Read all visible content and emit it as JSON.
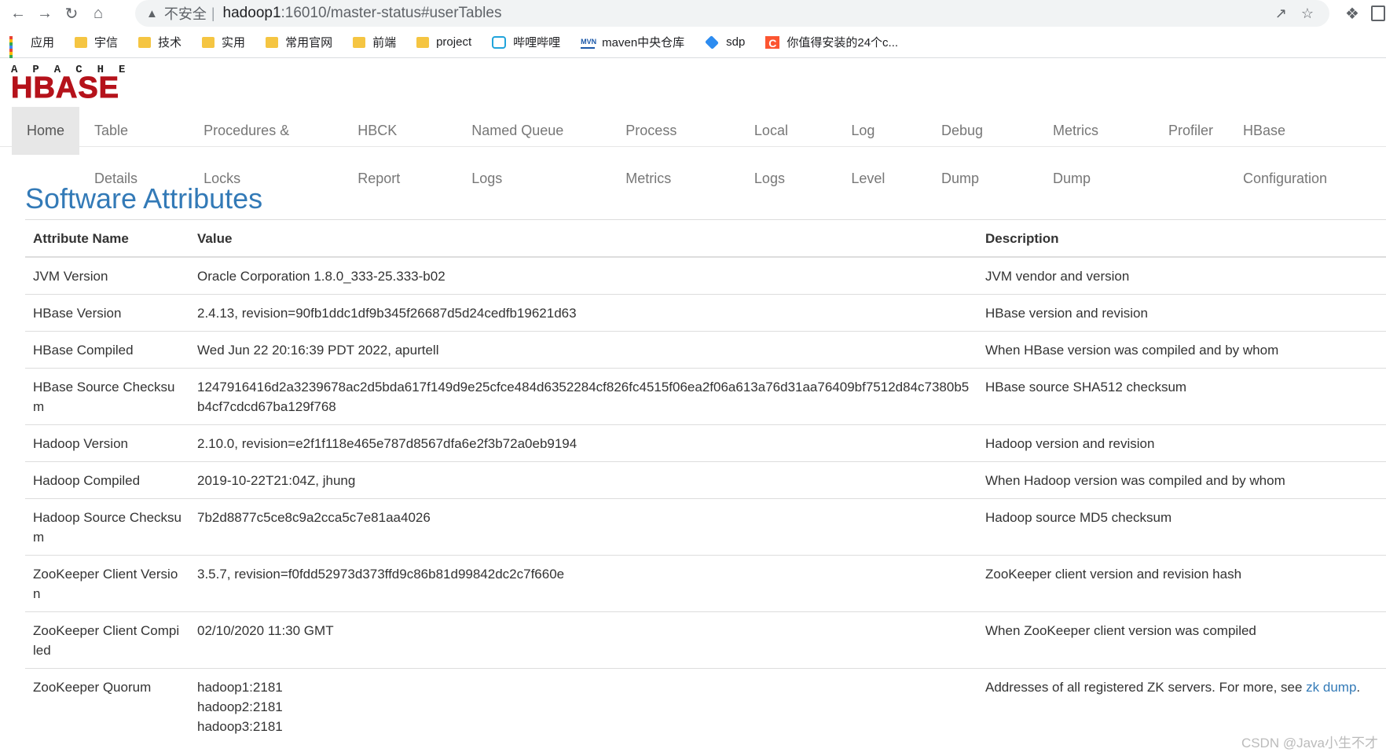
{
  "browser": {
    "insecure_label": "不安全",
    "url_host": "hadoop1",
    "url_rest": ":16010/master-status#userTables",
    "bookmarks": [
      {
        "label": "应用",
        "icon": "apps-grid-icon"
      },
      {
        "label": "宇信",
        "icon": "folder-icon"
      },
      {
        "label": "技术",
        "icon": "folder-icon"
      },
      {
        "label": "实用",
        "icon": "folder-icon"
      },
      {
        "label": "常用官网",
        "icon": "folder-icon"
      },
      {
        "label": "前端",
        "icon": "folder-icon"
      },
      {
        "label": "project",
        "icon": "folder-icon"
      },
      {
        "label": "哔哩哔哩",
        "icon": "bilibili-icon"
      },
      {
        "label": "maven中央仓库",
        "icon": "mvn-icon"
      },
      {
        "label": "sdp",
        "icon": "sdp-icon"
      },
      {
        "label": "你值得安装的24个c...",
        "icon": "csdn-icon"
      }
    ]
  },
  "header": {
    "logo_top": "APACHE",
    "logo_main": "HBASE",
    "nav": [
      "Home",
      "Table Details",
      "Procedures & Locks",
      "HBCK Report",
      "Named Queue Logs",
      "Process Metrics",
      "Local Logs",
      "Log Level",
      "Debug Dump",
      "Metrics Dump",
      "Profiler",
      "HBase Configuration"
    ]
  },
  "main": {
    "title": "Software Attributes",
    "columns": [
      "Attribute Name",
      "Value",
      "Description"
    ],
    "rows": [
      {
        "name": "JVM Version",
        "value": "Oracle Corporation 1.8.0_333-25.333-b02",
        "desc": "JVM vendor and version"
      },
      {
        "name": "HBase Version",
        "value": "2.4.13, revision=90fb1ddc1df9b345f26687d5d24cedfb19621d63",
        "desc": "HBase version and revision"
      },
      {
        "name": "HBase Compiled",
        "value": "Wed Jun 22 20:16:39 PDT 2022, apurtell",
        "desc": "When HBase version was compiled and by whom"
      },
      {
        "name": "HBase Source Checksum",
        "value": "1247916416d2a3239678ac2d5bda617f149d9e25cfce484d6352284cf826fc4515f06ea2f06a613a76d31aa76409bf7512d84c7380b5b4cf7cdcd67ba129f768",
        "desc": "HBase source SHA512 checksum"
      },
      {
        "name": "Hadoop Version",
        "value": "2.10.0, revision=e2f1f118e465e787d8567dfa6e2f3b72a0eb9194",
        "desc": "Hadoop version and revision"
      },
      {
        "name": "Hadoop Compiled",
        "value": "2019-10-22T21:04Z, jhung",
        "desc": "When Hadoop version was compiled and by whom"
      },
      {
        "name": "Hadoop Source Checksum",
        "value": "7b2d8877c5ce8c9a2cca5c7e81aa4026",
        "desc": "Hadoop source MD5 checksum"
      },
      {
        "name": "ZooKeeper Client Version",
        "value": "3.5.7, revision=f0fdd52973d373ffd9c86b81d99842dc2c7f660e",
        "desc": "ZooKeeper client version and revision hash"
      },
      {
        "name": "ZooKeeper Client Compiled",
        "value": "02/10/2020 11:30 GMT",
        "desc": "When ZooKeeper client version was compiled"
      }
    ],
    "quorum": {
      "name": "ZooKeeper Quorum",
      "servers": [
        "hadoop1:2181",
        "hadoop2:2181",
        "hadoop3:2181"
      ],
      "desc_prefix": "Addresses of all registered ZK servers. For more, see ",
      "desc_link": "zk dump",
      "desc_suffix": "."
    }
  },
  "watermark": "CSDN @Java小生不才"
}
